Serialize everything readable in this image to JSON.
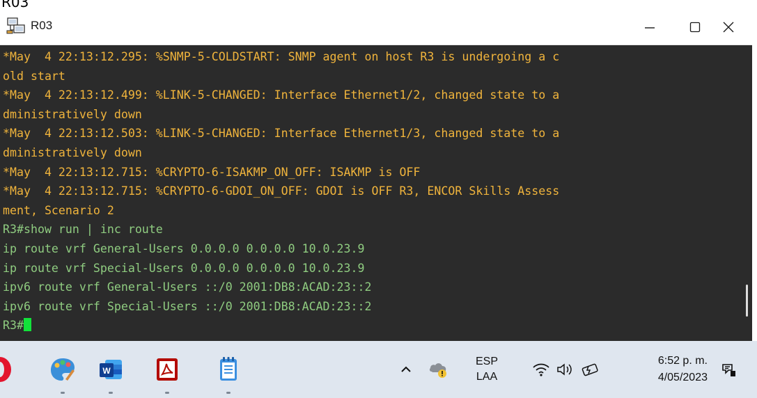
{
  "top_strip": {
    "text": "R03"
  },
  "window": {
    "title": "R03",
    "app_icon": "network-device-icon",
    "controls": {
      "minimize": "minimize-icon",
      "maximize": "maximize-icon",
      "close": "close-icon"
    }
  },
  "terminal": {
    "lines": [
      "*May  4 22:13:12.295: %SNMP-5-COLDSTART: SNMP agent on host R3 is undergoing a c",
      "old start",
      "*May  4 22:13:12.499: %LINK-5-CHANGED: Interface Ethernet1/2, changed state to a",
      "dministratively down",
      "*May  4 22:13:12.503: %LINK-5-CHANGED: Interface Ethernet1/3, changed state to a",
      "dministratively down",
      "*May  4 22:13:12.715: %CRYPTO-6-ISAKMP_ON_OFF: ISAKMP is OFF",
      "*May  4 22:13:12.715: %CRYPTO-6-GDOI_ON_OFF: GDOI is OFF R3, ENCOR Skills Assess",
      "ment, Scenario 2",
      "R3#show run | inc route",
      "ip route vrf General-Users 0.0.0.0 0.0.0.0 10.0.23.9",
      "ip route vrf Special-Users 0.0.0.0 0.0.0.0 10.0.23.9",
      "ipv6 route vrf General-Users ::/0 2001:DB8:ACAD:23::2",
      "ipv6 route vrf Special-Users ::/0 2001:DB8:ACAD:23::2"
    ],
    "prompt": "R3#",
    "colors": {
      "log": "#f0b43c",
      "command": "#8fcc80",
      "cursor": "#12e23a",
      "background": "#2b2b2b"
    }
  },
  "taskbar": {
    "apps": [
      {
        "icon": "opera-icon"
      },
      {
        "icon": "paint-icon"
      },
      {
        "icon": "word-icon",
        "glyph": "W"
      },
      {
        "icon": "acrobat-icon"
      },
      {
        "icon": "notepad-icon"
      }
    ],
    "tray": {
      "chevron_icon": "chevron-up-icon",
      "cloud_icon": "onedrive-warning-icon",
      "language": "ESP",
      "layout": "LAA",
      "wifi_icon": "wifi-icon",
      "volume_icon": "volume-icon",
      "battery_icon": "battery-charging-icon",
      "time": "6:52 p. m.",
      "date": "4/05/2023",
      "notification_icon": "notification-icon"
    }
  }
}
